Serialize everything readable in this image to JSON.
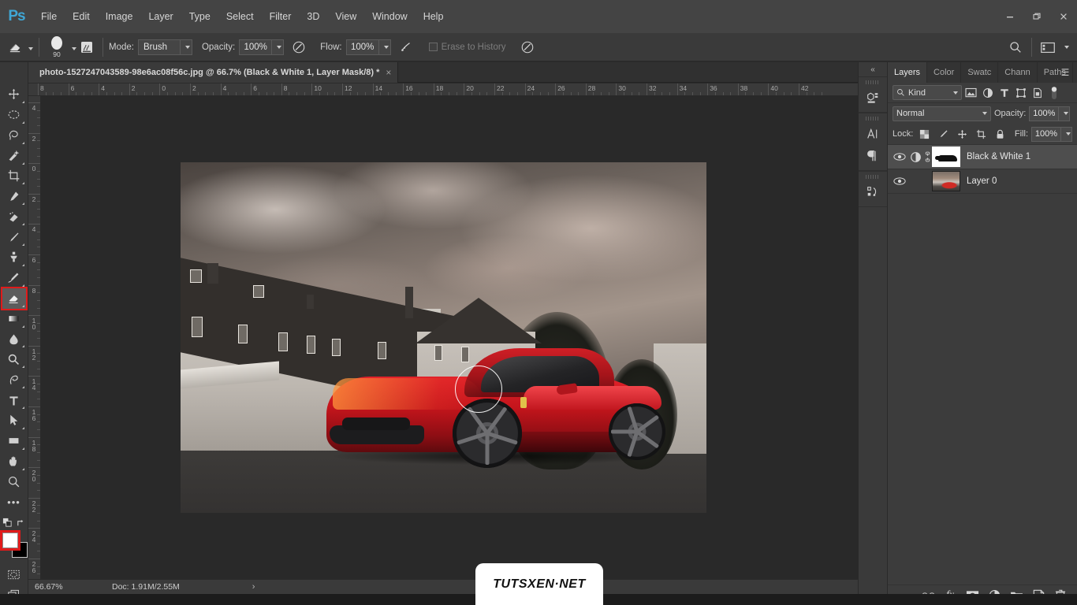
{
  "app": {
    "logo": "Ps",
    "menu": [
      "File",
      "Edit",
      "Image",
      "Layer",
      "Type",
      "Select",
      "Filter",
      "3D",
      "View",
      "Window",
      "Help"
    ],
    "window_controls": {
      "minimize": "—",
      "restore": "❐",
      "close": "✕"
    }
  },
  "options_bar": {
    "tool_icon": "eraser-icon",
    "brush_size": "90",
    "mode_label": "Mode:",
    "mode_value": "Brush",
    "opacity_label": "Opacity:",
    "opacity_value": "100%",
    "flow_label": "Flow:",
    "flow_value": "100%",
    "erase_to_history_label": "Erase to History",
    "search_icon": "search-icon",
    "workspace_icon": "workspace-icon"
  },
  "document": {
    "tab_title": "photo-1527247043589-98e6ac08f56c.jpg @ 66.7% (Black & White 1, Layer Mask/8) *",
    "close_glyph": "×"
  },
  "rulers": {
    "horizontal": [
      "8",
      "6",
      "4",
      "2",
      "0",
      "2",
      "4",
      "6",
      "8",
      "10",
      "12",
      "14",
      "16",
      "18",
      "20",
      "22",
      "24",
      "26",
      "28",
      "30",
      "32",
      "34",
      "36",
      "38",
      "40",
      "42"
    ],
    "vertical": [
      "4",
      "2",
      "0",
      "2",
      "4",
      "6",
      "8",
      "10",
      "12",
      "14",
      "16",
      "18",
      "20",
      "22",
      "24",
      "26"
    ]
  },
  "toolbar": {
    "tools": [
      {
        "name": "move-tool",
        "glyph": "✥",
        "selected": false
      },
      {
        "name": "marquee-tool",
        "glyph": "◯",
        "selected": false
      },
      {
        "name": "lasso-tool",
        "glyph": "⤵",
        "selected": false
      },
      {
        "name": "quick-selection-tool",
        "glyph": "✦",
        "selected": false
      },
      {
        "name": "crop-tool",
        "glyph": "⌧",
        "selected": false
      },
      {
        "name": "eyedropper-tool",
        "glyph": "✒",
        "selected": false
      },
      {
        "name": "spot-healing-tool",
        "glyph": "☙",
        "selected": false
      },
      {
        "name": "brush-tool",
        "glyph": "✐",
        "selected": false
      },
      {
        "name": "clone-stamp-tool",
        "glyph": "⚑",
        "selected": false
      },
      {
        "name": "history-brush-tool",
        "glyph": "✄",
        "selected": false
      },
      {
        "name": "eraser-tool",
        "glyph": "◩",
        "selected": true
      },
      {
        "name": "gradient-tool",
        "glyph": "▧",
        "selected": false
      },
      {
        "name": "blur-tool",
        "glyph": "●",
        "selected": false
      },
      {
        "name": "dodge-tool",
        "glyph": "⚲",
        "selected": false
      },
      {
        "name": "pen-tool",
        "glyph": "✒",
        "selected": false
      },
      {
        "name": "type-tool",
        "glyph": "T",
        "selected": false
      },
      {
        "name": "path-selection-tool",
        "glyph": "➤",
        "selected": false
      },
      {
        "name": "rectangle-tool",
        "glyph": "▭",
        "selected": false
      },
      {
        "name": "hand-tool",
        "glyph": "✋",
        "selected": false
      },
      {
        "name": "zoom-tool",
        "glyph": "⚲",
        "selected": false
      },
      {
        "name": "edit-toolbar-tool",
        "glyph": "•••",
        "selected": false
      }
    ],
    "foreground_color": "#ffffff",
    "background_color": "#000000",
    "quick_mask_icon": "quick-mask-icon",
    "screen_mode_icon": "screen-mode-icon"
  },
  "dock_rail": {
    "collapse_glyph": "«",
    "icons": [
      {
        "name": "properties-icon",
        "glyph": "⬚"
      },
      {
        "name": "character-icon",
        "glyph": "A"
      },
      {
        "name": "paragraph-icon",
        "glyph": "¶"
      },
      {
        "name": "history-icon",
        "glyph": "↺"
      }
    ]
  },
  "layers_panel": {
    "tabs": [
      {
        "label": "Layers",
        "active": true
      },
      {
        "label": "Color",
        "active": false
      },
      {
        "label": "Swatc",
        "active": false
      },
      {
        "label": "Chann",
        "active": false
      },
      {
        "label": "Paths",
        "active": false
      }
    ],
    "menu_glyph": "☰",
    "filter": {
      "kind_label": "Kind",
      "search_icon": "search-icon",
      "icons": [
        "pixel-filter-icon",
        "adjustment-filter-icon",
        "type-filter-icon",
        "shape-filter-icon",
        "smart-object-filter-icon"
      ],
      "toggle": "filter-toggle"
    },
    "blend_mode": "Normal",
    "opacity_label": "Opacity:",
    "opacity_value": "100%",
    "lock_label": "Lock:",
    "lock_icons": [
      "lock-transparent-icon",
      "lock-image-icon",
      "lock-position-icon",
      "lock-artboard-icon",
      "lock-all-icon"
    ],
    "fill_label": "Fill:",
    "fill_value": "100%",
    "layers": [
      {
        "name": "Black & White 1",
        "selected": true,
        "visible": true,
        "type": "adjustment-mask"
      },
      {
        "name": "Layer 0",
        "selected": false,
        "visible": true,
        "type": "pixel"
      }
    ],
    "footer_icons": [
      {
        "name": "link-layers-icon",
        "glyph": "⚭"
      },
      {
        "name": "layer-style-icon",
        "glyph": "fx"
      },
      {
        "name": "add-mask-icon",
        "glyph": "◉"
      },
      {
        "name": "new-adjustment-icon",
        "glyph": "◑"
      },
      {
        "name": "new-group-icon",
        "glyph": "▰"
      },
      {
        "name": "new-layer-icon",
        "glyph": "❐"
      },
      {
        "name": "delete-layer-icon",
        "glyph": "🗑"
      }
    ]
  },
  "status_bar": {
    "zoom": "66.67%",
    "doc_info": "Doc: 1.91M/2.55M",
    "arrow_glyph": "›"
  },
  "watermark": {
    "text": "TUTSXEN·NET"
  },
  "canvas": {
    "brush_cursor": "eraser-brush-cursor",
    "image_alt": "red-ferrari-in-front-of-chateau"
  },
  "colors": {
    "menubar_bg": "#444444",
    "options_bg": "#3a3a3a",
    "panel_bg": "#3c3c3c",
    "canvas_bg": "#292929",
    "accent_red": "#e01b1b",
    "logo_blue": "#3fa7d6"
  }
}
